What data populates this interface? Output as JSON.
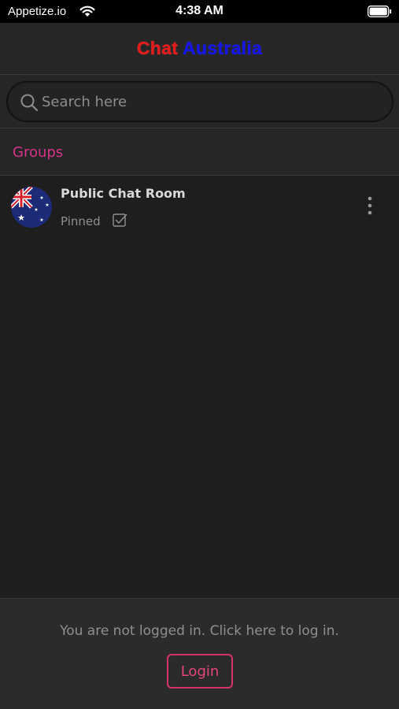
{
  "status_bar": {
    "carrier": "Appetize.io",
    "time": "4:38 AM"
  },
  "header": {
    "title_part1": "Chat",
    "title_part2": "Australia"
  },
  "search": {
    "placeholder": "Search here"
  },
  "groups": {
    "heading": "Groups",
    "items": [
      {
        "name": "Public Chat Room",
        "status": "Pinned",
        "avatar": "australian-flag-icon"
      }
    ]
  },
  "footer": {
    "message": "You are not logged in. Click here to log in.",
    "login_label": "Login"
  },
  "colors": {
    "accent": "#d6336c",
    "groups_heading": "#d6338a",
    "title_red": "#e51b1b",
    "title_blue": "#1414e6"
  }
}
